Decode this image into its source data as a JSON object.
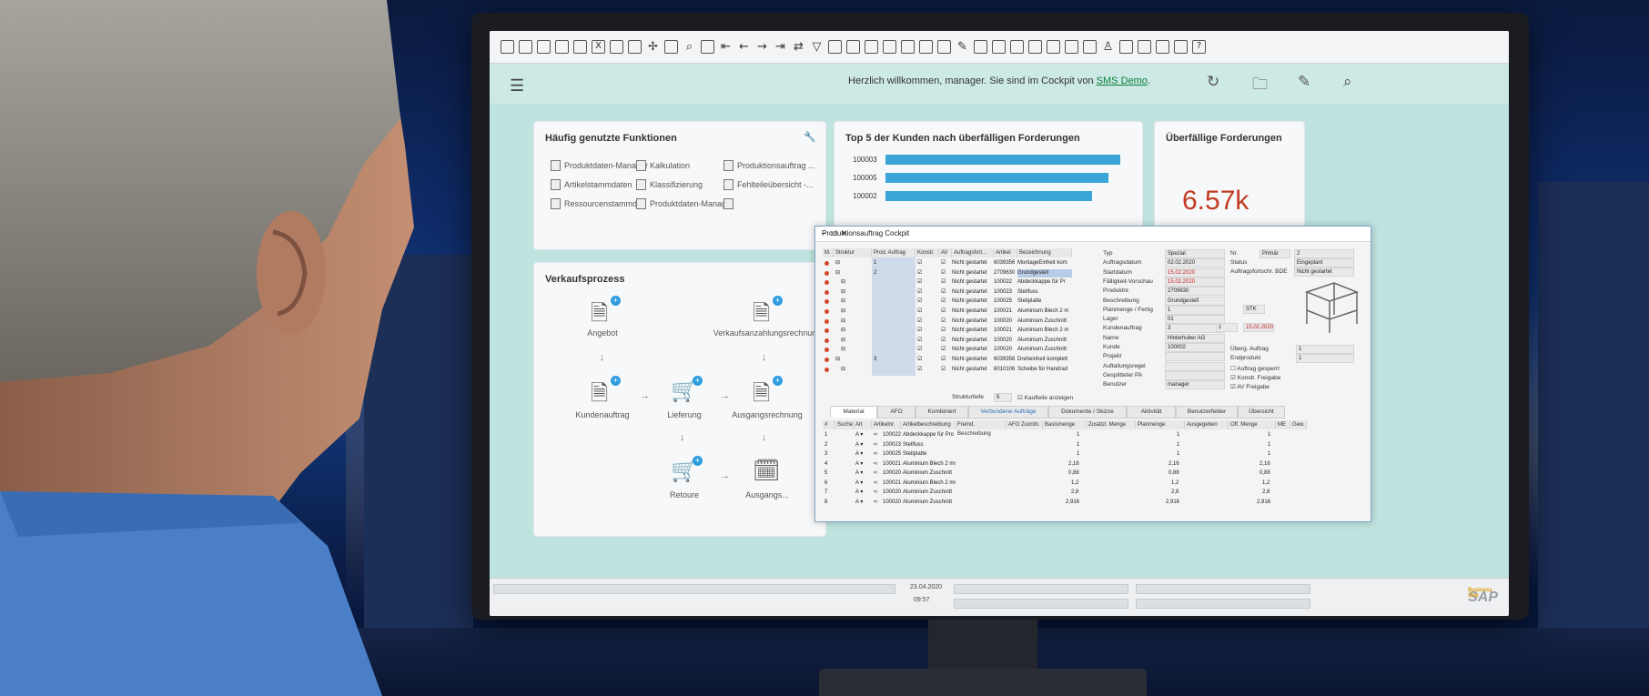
{
  "welcome": {
    "text": "Herzlich willkommen, manager. Sie sind im Cockpit von ",
    "company": "SMS Demo",
    "suffix": "."
  },
  "cards": {
    "functions": {
      "title": "Häufig genutzte Funktionen",
      "items": [
        "Produktdaten-Manager",
        "Kalkulation",
        "Produktionsauftrag ...",
        "Artikelstammdaten",
        "Klassifizierung",
        "Fehlteileübersicht -...",
        "Ressourcenstammd...",
        "Produktdaten-Manager"
      ]
    },
    "top5": {
      "title": "Top 5 der Kunden nach überfälligen Forderungen"
    },
    "overdue": {
      "title": "Überfällige Forderungen",
      "value": "6.57k"
    },
    "sales": {
      "title": "Verkaufsprozess",
      "labels": [
        "Angebot",
        "Verkaufsanzahlungsrechnung",
        "Kundenauftrag",
        "Lieferung",
        "Ausgangsrechnung",
        "Retoure",
        "Ausgangs..."
      ]
    }
  },
  "chart_data": {
    "type": "bar",
    "categories": [
      "100003",
      "100005",
      "100002"
    ],
    "values": [
      1.0,
      0.95,
      0.88
    ],
    "title": "Top 5 der Kunden nach überfälligen Forderungen"
  },
  "prod": {
    "title": "Produktionsauftrag Cockpit",
    "headers": [
      "M.",
      "Struktur",
      "Prod. Auftrag",
      "Konstr.",
      "AV",
      "Auftragsfort...",
      "Artikel",
      "Bezeichnung"
    ],
    "rows": [
      {
        "order": "1",
        "status": "Nicht gestartet",
        "art": "6039356",
        "desc": "MontageEinheit kom"
      },
      {
        "order": "2",
        "status": "Nicht gestartet",
        "art": "2709630",
        "desc": "Grundgestell"
      },
      {
        "order": "",
        "status": "Nicht gestartet",
        "art": "100022",
        "desc": "Abdeckkappe für Pr"
      },
      {
        "order": "",
        "status": "Nicht gestartet",
        "art": "100023",
        "desc": "Stellfuss"
      },
      {
        "order": "",
        "status": "Nicht gestartet",
        "art": "100025",
        "desc": "Stellplatte"
      },
      {
        "order": "",
        "status": "Nicht gestartet",
        "art": "100021",
        "desc": "Aluminium Blech 2 m"
      },
      {
        "order": "",
        "status": "Nicht gestartet",
        "art": "100020",
        "desc": "Aluminium Zuschnitt"
      },
      {
        "order": "",
        "status": "Nicht gestartet",
        "art": "100021",
        "desc": "Aluminium Blech 2 m"
      },
      {
        "order": "",
        "status": "Nicht gestartet",
        "art": "100020",
        "desc": "Aluminium Zuschnitt"
      },
      {
        "order": "",
        "status": "Nicht gestartet",
        "art": "100020",
        "desc": "Aluminium Zuschnitt"
      },
      {
        "order": "3",
        "status": "Nicht gestartet",
        "art": "6039356",
        "desc": "Dreheinheit komplett"
      },
      {
        "order": "",
        "status": "Nicht gestartet",
        "art": "6010106",
        "desc": "Scheibe für Handrad"
      }
    ],
    "fields": [
      {
        "label": "Typ",
        "value": "Spezial"
      },
      {
        "label": "Auftragsdatum",
        "value": "02.02.2020"
      },
      {
        "label": "Startdatum",
        "value": "15.02.2020"
      },
      {
        "label": "Fälligkeit-Vorschau",
        "value": "15.02.2020"
      },
      {
        "label": "Produktnr.",
        "value": "2709630"
      },
      {
        "label": "Beschreibung",
        "value": "Grundgestell"
      },
      {
        "label": "Planmenge / Fertig",
        "value": "1"
      },
      {
        "label": "Lager",
        "value": "01"
      },
      {
        "label": "Kundenauftrag",
        "value": "3"
      },
      {
        "label": "Name",
        "value": "Hinterhuber AG"
      },
      {
        "label": "Kunde",
        "value": "100002"
      },
      {
        "label": "Projekt",
        "value": ""
      },
      {
        "label": "Auftailungsregel",
        "value": ""
      },
      {
        "label": "Gesplitteter PA",
        "value": ""
      },
      {
        "label": "Benutzer",
        "value": "manager"
      }
    ],
    "right": {
      "nr_label": "Nr.",
      "nr_type": "Primär",
      "nr_val": "2",
      "status_label": "Status",
      "status_val": "Eingeplant",
      "prog_label": "Auftragsfortschr. BDE",
      "prog_val": "Nicht gestartet",
      "stk": "STK",
      "ka_pos": "1",
      "ka_date": "15.02.2020",
      "uebg": "Überg. Auftrag",
      "uebg_val": "1",
      "endp": "Endprodukt",
      "endp_val": "1",
      "chk1": "Auftrag gesperrt",
      "chk2": "Konstr. Freigabe",
      "chk3": "AV Freigabe"
    },
    "strukt_label": "Strukturtiefe",
    "strukt_val": "5",
    "kauf_label": "Kaufteile anzeigen",
    "tabs": [
      "Material",
      "AFO",
      "Kombiniert",
      "Verbundene Aufträge",
      "Dokumente / Skizze",
      "Aktivität",
      "Benutzerfelder",
      "Übersicht"
    ],
    "mat_headers": [
      "#",
      "Suche",
      "Art",
      "Artikelnr.",
      "Artikelbeschreibung",
      "Fremd. Beschreibung",
      "AFO Zuordn.",
      "Basismenge",
      "Zusätzl. Menge",
      "Planmenge",
      "Ausgegeben",
      "Off. Menge",
      "ME",
      "Gew."
    ],
    "mat_rows": [
      {
        "n": "1",
        "art": "100022",
        "desc": "Abdeckkappe für Pro",
        "basis": "1",
        "plan": "1",
        "off": "1"
      },
      {
        "n": "2",
        "art": "100023",
        "desc": "Stellfuss",
        "basis": "1",
        "plan": "1",
        "off": "1"
      },
      {
        "n": "3",
        "art": "100025",
        "desc": "Stellplatte",
        "basis": "1",
        "plan": "1",
        "off": "1"
      },
      {
        "n": "4",
        "art": "100021",
        "desc": "Aluminium Blech 2 mr",
        "basis": "2,16",
        "plan": "2,16",
        "off": "2,16"
      },
      {
        "n": "5",
        "art": "100020",
        "desc": "Aluminium Zuschnitt",
        "basis": "0,88",
        "plan": "0,88",
        "off": "0,88"
      },
      {
        "n": "6",
        "art": "100021",
        "desc": "Aluminium Blech 2 mr",
        "basis": "1,2",
        "plan": "1,2",
        "off": "1,2"
      },
      {
        "n": "7",
        "art": "100020",
        "desc": "Aluminium Zuschnitt",
        "basis": "2,8",
        "plan": "2,8",
        "off": "2,8"
      },
      {
        "n": "8",
        "art": "100020",
        "desc": "Aluminium Zuschnitt",
        "basis": "2,916",
        "plan": "2,916",
        "off": "2,916"
      }
    ],
    "art_val": "A"
  },
  "status": {
    "date": "23.04.2020",
    "time": "09:57",
    "brand": "SAP",
    "brand_sub": "Business One"
  }
}
